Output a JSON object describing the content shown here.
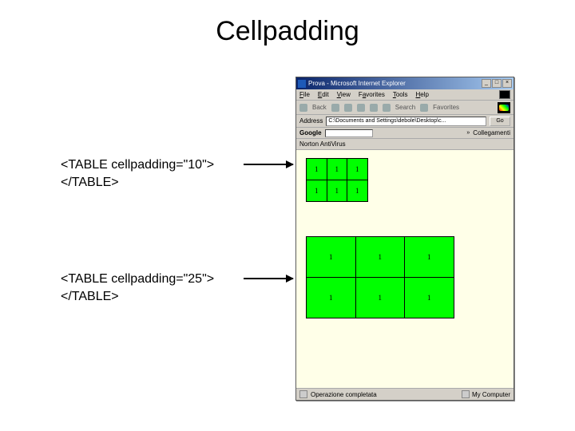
{
  "title": "Cellpadding",
  "code1_line1": "<TABLE cellpadding=\"10\">",
  "code1_line2": "</TABLE>",
  "code2_line1": "<TABLE cellpadding=\"25\">",
  "code2_line2": "</TABLE>",
  "browser": {
    "window_title": "Prova - Microsoft Internet Explorer",
    "menu": {
      "file": "File",
      "edit": "Edit",
      "view": "View",
      "favorites": "Favorites",
      "tools": "Tools",
      "help": "Help"
    },
    "toolbar": {
      "back": "Back",
      "search": "Search",
      "favorites": "Favorites"
    },
    "address_label": "Address",
    "address_value": "C:\\Documents and Settings\\debole\\Desktop\\c...",
    "go_label": "Go",
    "collegamenti_label": "Collegamenti",
    "google_label": "Google",
    "chev": "»",
    "norton_label": "Norton AntiVirus",
    "status_text": "Operazione completata",
    "zone_label": "My Computer"
  },
  "table_cell": "1"
}
